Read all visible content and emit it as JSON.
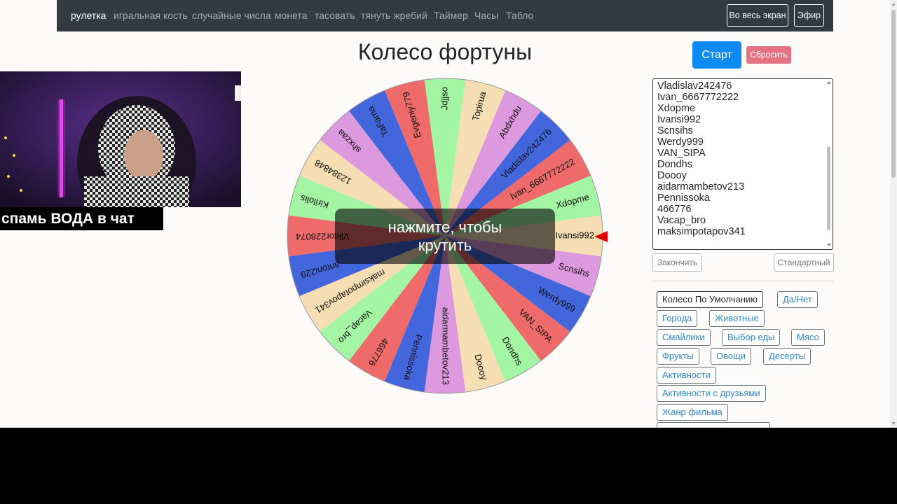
{
  "navbar": {
    "links": [
      "рулетка",
      "игральная кость",
      "случайные числа",
      "монета",
      "тасовать",
      "тянуть жребий",
      "Таймер",
      "Часы",
      "Табло"
    ],
    "fullscreen_label": "Во весь экран",
    "broadcast_label": "Эфир"
  },
  "title": "Колесо фортуны",
  "wheel": {
    "overlay_line1": "нажмите, чтобы",
    "overlay_line2": "крутить",
    "labels": [
      "Ivansi992",
      "Xdopme",
      "Ivan_6667772222",
      "Vladislav242476",
      "Abdxhdu",
      "Topirua",
      "Jdjjso",
      "Evgeniy779",
      "TaFama",
      "shxzaa",
      "12384848",
      "Kirilolis",
      "Viktor228074",
      "antoni229",
      "maksimpotapov341",
      "Vacap_bro",
      "466776",
      "Pennissoka",
      "aidarmambetov213",
      "Doooy",
      "Dondhs",
      "VAN_SIPA",
      "Werdy999",
      "Scnsihs"
    ],
    "colors": [
      "#f5deb3",
      "#a3f5a3",
      "#ef6b6b",
      "#4466dd",
      "#dd99dd",
      "#f5deb3",
      "#a3f5a3",
      "#ef6b6b",
      "#4466dd",
      "#dd99dd",
      "#f5deb3",
      "#a3f5a3",
      "#ef6b6b",
      "#4466dd",
      "#f5deb3",
      "#a3f5a3",
      "#ef6b6b",
      "#4466dd",
      "#dd99dd",
      "#f5deb3",
      "#a3f5a3",
      "#ef6b6b",
      "#4466dd",
      "#dd99dd"
    ],
    "pointer_color": "#e00000"
  },
  "buttons": {
    "start": "Старт",
    "reset": "Сбросить",
    "finish": "Закончить",
    "standard": "Стандартный"
  },
  "names_list": [
    "Vladislav242476",
    "Ivan_6667772222",
    "Xdopme",
    "Ivansi992",
    "Scnsihs",
    "Werdy999",
    "VAN_SIPA",
    "Dondhs",
    "Doooy",
    "aidarmambetov213",
    "Pennissoka",
    "466776",
    "Vacap_bro",
    "maksimpotapov341"
  ],
  "presets": {
    "default": "Колесо По Умолчанию",
    "yes_no": "Да/Нет",
    "cities": "Города",
    "animals": "Животные",
    "emoji": "Смайлики",
    "food": "Выбор еды",
    "meat": "Мясо",
    "fruits": "Фрукты",
    "vegetables": "Овощи",
    "desserts": "Десерты",
    "activities": "Активности",
    "activities_friends": "Активности с друзьями",
    "genre": "Жанр фильма"
  },
  "webcam": {
    "banner": "спамь ВОДА в чат"
  }
}
